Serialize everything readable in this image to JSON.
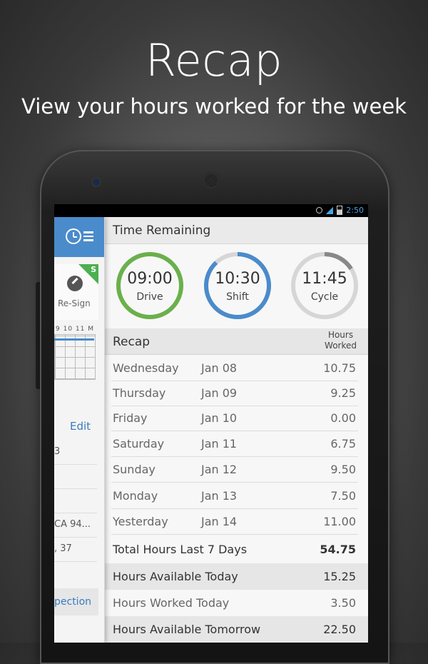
{
  "promo": {
    "title": "Recap",
    "subtitle": "View your hours worked for the week"
  },
  "status_bar": {
    "time": "2:50"
  },
  "drawer": {
    "badge": "S",
    "resign_label": "Re-Sign",
    "grid_hours": "9  10  11  M",
    "edit_label": "Edit",
    "rows": [
      "3",
      "",
      "",
      "CA 94...",
      ", 37"
    ],
    "inspection_label": "pection"
  },
  "time_remaining": {
    "title": "Time Remaining",
    "gauges": [
      {
        "time": "09:00",
        "label": "Drive",
        "color": "#6ab04c",
        "fraction": 1.0
      },
      {
        "time": "10:30",
        "label": "Shift",
        "color": "#4a8bcb",
        "fraction": 0.88
      },
      {
        "time": "11:45",
        "label": "Cycle",
        "color": "#888888",
        "fraction": 0.16
      }
    ]
  },
  "recap": {
    "title": "Recap",
    "hours_worked_label_1": "Hours",
    "hours_worked_label_2": "Worked",
    "rows": [
      {
        "day": "Wednesday",
        "date": "Jan 08",
        "hours": "10.75"
      },
      {
        "day": "Thursday",
        "date": "Jan 09",
        "hours": "9.25"
      },
      {
        "day": "Friday",
        "date": "Jan 10",
        "hours": "0.00"
      },
      {
        "day": "Saturday",
        "date": "Jan 11",
        "hours": "6.75"
      },
      {
        "day": "Sunday",
        "date": "Jan 12",
        "hours": "9.50"
      },
      {
        "day": "Monday",
        "date": "Jan 13",
        "hours": "7.50"
      },
      {
        "day": "Yesterday",
        "date": "Jan 14",
        "hours": "11.00"
      }
    ]
  },
  "summary": [
    {
      "label": "Total Hours Last 7 Days",
      "value": "54.75"
    },
    {
      "label": "Hours Available Today",
      "value": "15.25"
    },
    {
      "label": "Hours Worked Today",
      "value": "3.50"
    },
    {
      "label": "Hours Available Tomorrow",
      "value": "22.50"
    }
  ]
}
